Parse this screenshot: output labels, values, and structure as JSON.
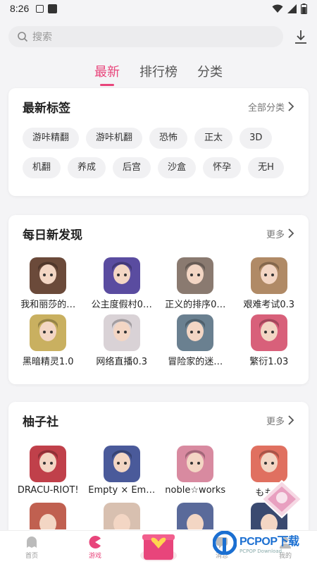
{
  "status": {
    "time": "8:26"
  },
  "search": {
    "placeholder": "搜索"
  },
  "tabs": [
    {
      "label": "最新",
      "active": true
    },
    {
      "label": "排行榜",
      "active": false
    },
    {
      "label": "分类",
      "active": false
    }
  ],
  "latest_tags": {
    "title": "最新标签",
    "more": "全部分类",
    "tags": [
      "游咔精翻",
      "游咔机翻",
      "恐怖",
      "正太",
      "3D",
      "机翻",
      "养成",
      "后宫",
      "沙盒",
      "怀孕",
      "无H"
    ]
  },
  "daily": {
    "title": "每日新发现",
    "more": "更多",
    "games": [
      {
        "name": "我和丽莎的…",
        "color": "#6b4a3a"
      },
      {
        "name": "公主度假村0…",
        "color": "#5a4ca0"
      },
      {
        "name": "正义的排序0…",
        "color": "#8a7a70"
      },
      {
        "name": "艰难考试0.3",
        "color": "#b08a66"
      },
      {
        "name": "黑暗精灵1.0",
        "color": "#c9b060"
      },
      {
        "name": "网络直播0.3",
        "color": "#d9d2d6"
      },
      {
        "name": "冒险家的迷…",
        "color": "#6a8090"
      },
      {
        "name": "繁衍1.03",
        "color": "#d8607a"
      }
    ]
  },
  "yuzu": {
    "title": "柚子社",
    "more": "更多",
    "games": [
      {
        "name": "DRACU-RIOT!",
        "color": "#c0404a"
      },
      {
        "name": "Empty × Em…",
        "color": "#4a5a9a"
      },
      {
        "name": "noble☆works",
        "color": "#d88aa0"
      },
      {
        "name": "もも…",
        "color": "#e07060"
      }
    ],
    "partial_row_colors": [
      "#c06050",
      "#d8c0b0",
      "#5a6a9a",
      "#3a4a70"
    ]
  },
  "nav": [
    {
      "label": "首页",
      "icon": "ghost-icon",
      "active": false
    },
    {
      "label": "游戏",
      "icon": "pacman-icon",
      "active": true
    },
    {
      "label": "",
      "icon": "gift-icon",
      "active": false
    },
    {
      "label": "消息",
      "icon": "message-icon",
      "active": false
    },
    {
      "label": "我的",
      "icon": "profile-icon",
      "active": false
    }
  ],
  "watermark": {
    "brand": "PCPOP下载",
    "sub": "PCPOP Download"
  },
  "colors": {
    "accent": "#e8457b",
    "brand_blue": "#1b6fd1"
  }
}
